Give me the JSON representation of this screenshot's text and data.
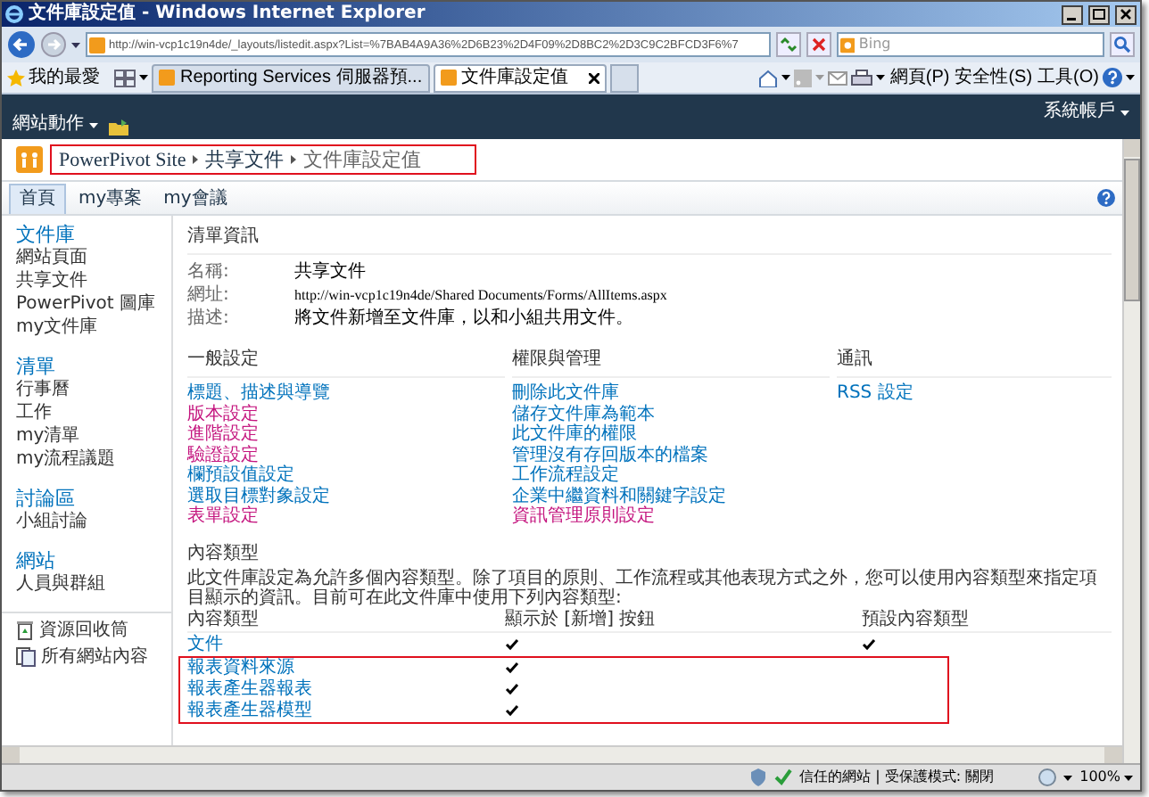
{
  "window": {
    "title": "文件庫設定值 - Windows Internet Explorer"
  },
  "address": {
    "url": "http://win-vcp1c19n4de/_layouts/listedit.aspx?List=%7BAB4A9A36%2D6B23%2D4F09%2D8BC2%2D3C9C2BFCD3F6%7"
  },
  "search": {
    "placeholder": "Bing"
  },
  "favorites": {
    "label": "我的最愛"
  },
  "browser_tabs": [
    {
      "label": "Reporting Services 伺服器預...",
      "selected": false
    },
    {
      "label": "文件庫設定值",
      "selected": true
    }
  ],
  "command_bar": [
    "網頁(P)",
    "安全性(S)",
    "工具(O)"
  ],
  "ribbon": {
    "site_actions": "網站動作",
    "user": "系統帳戶"
  },
  "breadcrumb": {
    "highlighted": true,
    "items": [
      "PowerPivot Site",
      "共享文件",
      "文件庫設定值"
    ]
  },
  "top_nav": [
    {
      "label": "首頁",
      "selected": true
    },
    {
      "label": "my專案",
      "selected": false
    },
    {
      "label": "my會議",
      "selected": false
    }
  ],
  "quick_launch": [
    {
      "heading": "文件庫",
      "items": [
        "網站頁面",
        "共享文件",
        "PowerPivot 圖庫",
        "my文件庫"
      ]
    },
    {
      "heading": "清單",
      "items": [
        "行事曆",
        "工作",
        "my清單",
        "my流程議題"
      ]
    },
    {
      "heading": "討論區",
      "items": [
        "小組討論"
      ]
    },
    {
      "heading": "網站",
      "items": [
        "人員與群組"
      ]
    }
  ],
  "quick_launch_footer": [
    {
      "kind": "recycle",
      "label": "資源回收筒"
    },
    {
      "kind": "pages",
      "label": "所有網站內容"
    }
  ],
  "list_info": {
    "heading": "清單資訊",
    "fields": [
      {
        "label": "名稱:",
        "value": "共享文件"
      },
      {
        "label": "網址:",
        "value": "http://win-vcp1c19n4de/Shared Documents/Forms/AllItems.aspx"
      },
      {
        "label": "描述:",
        "value": "將文件新增至文件庫，以和小組共用文件。"
      }
    ]
  },
  "settings": [
    {
      "heading": "一般設定",
      "links": [
        {
          "label": "標題、描述與導覽",
          "color": "#0072bc"
        },
        {
          "label": "版本設定",
          "color": "#c4147e"
        },
        {
          "label": "進階設定",
          "color": "#c4147e"
        },
        {
          "label": "驗證設定",
          "color": "#c4147e"
        },
        {
          "label": "欄預設值設定",
          "color": "#0072bc"
        },
        {
          "label": "選取目標對象設定",
          "color": "#0072bc"
        },
        {
          "label": "表單設定",
          "color": "#c4147e"
        }
      ]
    },
    {
      "heading": "權限與管理",
      "links": [
        {
          "label": "刪除此文件庫",
          "color": "#0072bc"
        },
        {
          "label": "儲存文件庫為範本",
          "color": "#0072bc"
        },
        {
          "label": "此文件庫的權限",
          "color": "#0072bc"
        },
        {
          "label": "管理沒有存回版本的檔案",
          "color": "#0072bc"
        },
        {
          "label": "工作流程設定",
          "color": "#0072bc"
        },
        {
          "label": "企業中繼資料和關鍵字設定",
          "color": "#0072bc"
        },
        {
          "label": "資訊管理原則設定",
          "color": "#c4147e"
        }
      ]
    },
    {
      "heading": "通訊",
      "links": [
        {
          "label": "RSS 設定",
          "color": "#0072bc"
        }
      ]
    }
  ],
  "content_types": {
    "heading": "內容類型",
    "description": "此文件庫設定為允許多個內容類型。除了項目的原則、工作流程或其他表現方式之外，您可以使用內容類型來指定項目顯示的資訊。目前可在此文件庫中使用下列內容類型:",
    "columns": [
      "內容類型",
      "顯示於 [新增] 按鈕",
      "預設內容類型"
    ],
    "rows": [
      {
        "name": "文件",
        "visible": true,
        "default": true,
        "highlighted": false
      },
      {
        "name": "報表資料來源",
        "visible": true,
        "default": false,
        "highlighted": true
      },
      {
        "name": "報表產生器報表",
        "visible": true,
        "default": false,
        "highlighted": true
      },
      {
        "name": "報表產生器模型",
        "visible": true,
        "default": false,
        "highlighted": true
      }
    ]
  },
  "status_bar": {
    "zone": "信任的網站 | 受保護模式: 關閉",
    "zoom": "100%"
  }
}
